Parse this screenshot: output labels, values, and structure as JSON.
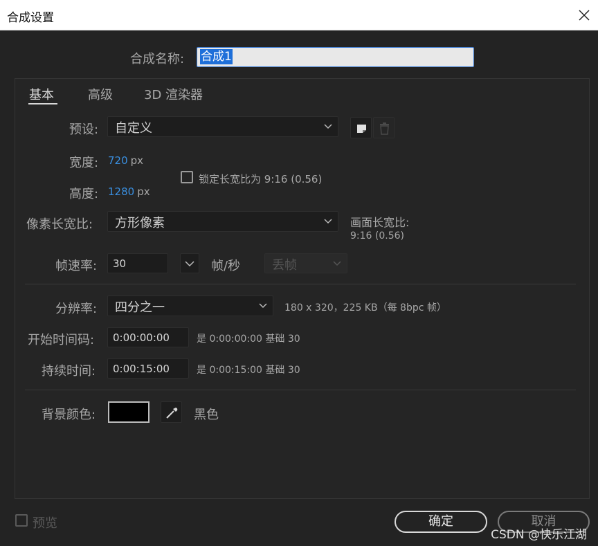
{
  "window": {
    "title": "合成设置"
  },
  "comp_name": {
    "label": "合成名称:",
    "value": "合成1"
  },
  "tabs": [
    {
      "label": "基本",
      "active": true
    },
    {
      "label": "高级",
      "active": false
    },
    {
      "label": "3D 渲染器",
      "active": false
    }
  ],
  "preset": {
    "label": "预设:",
    "value": "自定义"
  },
  "width": {
    "label": "宽度:",
    "value": "720",
    "unit": "px"
  },
  "height": {
    "label": "高度:",
    "value": "1280",
    "unit": "px"
  },
  "lock_ratio": {
    "label": "锁定长宽比为 9:16 (0.56)",
    "checked": false
  },
  "pixel_aspect": {
    "label": "像素长宽比:",
    "value": "方形像素"
  },
  "frame_aspect": {
    "label": "画面长宽比:",
    "value": "9:16 (0.56)"
  },
  "frame_rate": {
    "label": "帧速率:",
    "value": "30",
    "unit": "帧/秒",
    "drop_frame": "丢帧"
  },
  "resolution": {
    "label": "分辨率:",
    "value": "四分之一",
    "info": "180 x 320，225 KB（每 8bpc 帧）"
  },
  "start_timecode": {
    "label": "开始时间码:",
    "value": "0:00:00:00",
    "info": "是 0:00:00:00  基础 30"
  },
  "duration": {
    "label": "持续时间:",
    "value": "0:00:15:00",
    "info": "是 0:00:15:00  基础 30"
  },
  "background": {
    "label": "背景颜色:",
    "color": "#000000",
    "name": "黑色"
  },
  "preview": {
    "label": "预览",
    "checked": false
  },
  "buttons": {
    "ok": "确定",
    "cancel": "取消"
  },
  "watermark": "CSDN @快乐江湖",
  "colors": {
    "accent": "#3a8fe0",
    "selection": "#1e6fd9",
    "background": "#232323"
  }
}
